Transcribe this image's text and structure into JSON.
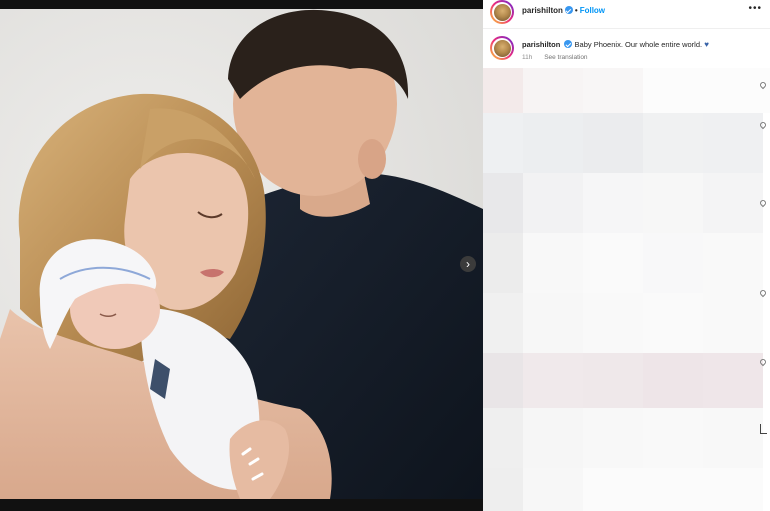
{
  "post": {
    "username": "parishilton",
    "follow_label": "Follow",
    "more_label": "•••",
    "caption_user": "parishilton",
    "caption_text": "Baby Phoenix. Our whole entire world.",
    "caption_emoji": "♥",
    "timestamp": "11h",
    "see_translation": "See translation"
  },
  "media": {
    "next_label": "›"
  },
  "colors": {
    "accent": "#0095f6",
    "verified": "#3897f0",
    "heart": "#3863a8",
    "bar": "#111111"
  }
}
